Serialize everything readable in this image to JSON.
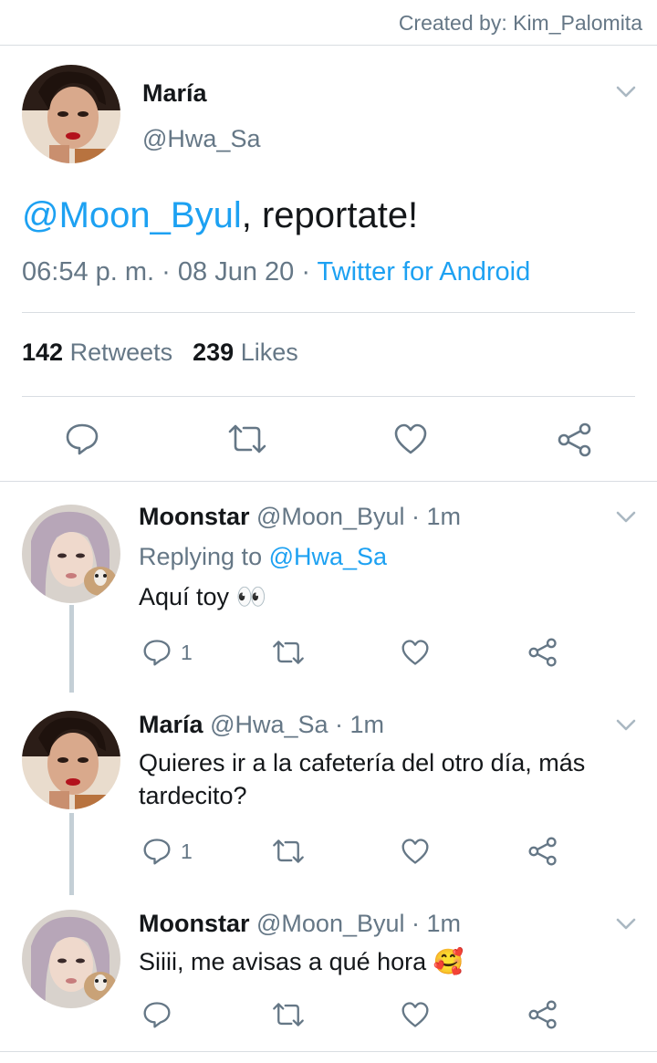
{
  "credit": "Created by: Kim_Palomita",
  "main_tweet": {
    "name": "María",
    "handle": "@Hwa_Sa",
    "mention": "@Moon_Byul",
    "text": ", reportate!",
    "time": "06:54 p. m.",
    "sep1": " · ",
    "date": "08 Jun 20",
    "sep2": " · ",
    "source": "Twitter for Android",
    "retweets_count": "142",
    "retweets_label": "Retweets",
    "likes_count": "239",
    "likes_label": "Likes"
  },
  "replies": [
    {
      "name": "Moonstar",
      "handle": "@Moon_Byul",
      "time": "· 1m",
      "replying_prefix": "Replying to ",
      "replying_handle": "@Hwa_Sa",
      "text": "Aquí toy 👀",
      "reply_count": "1"
    },
    {
      "name": "María",
      "handle": "@Hwa_Sa",
      "time": "· 1m",
      "text_line1": "Quieres ir a la cafetería del otro día, más",
      "text_line2": "tardecito?",
      "reply_count": "1"
    },
    {
      "name": "Moonstar",
      "handle": "@Moon_Byul",
      "time": "· 1m",
      "text": "Siiii, me avisas a qué hora 🥰"
    }
  ],
  "icons": [
    "chevron-down-icon",
    "reply-icon",
    "retweet-icon",
    "like-icon",
    "share-icon"
  ],
  "colors": {
    "link": "#1da1f2",
    "muted": "#657786",
    "text": "#14171a",
    "divider": "#d9dde2",
    "thread": "#c4cfd6"
  }
}
